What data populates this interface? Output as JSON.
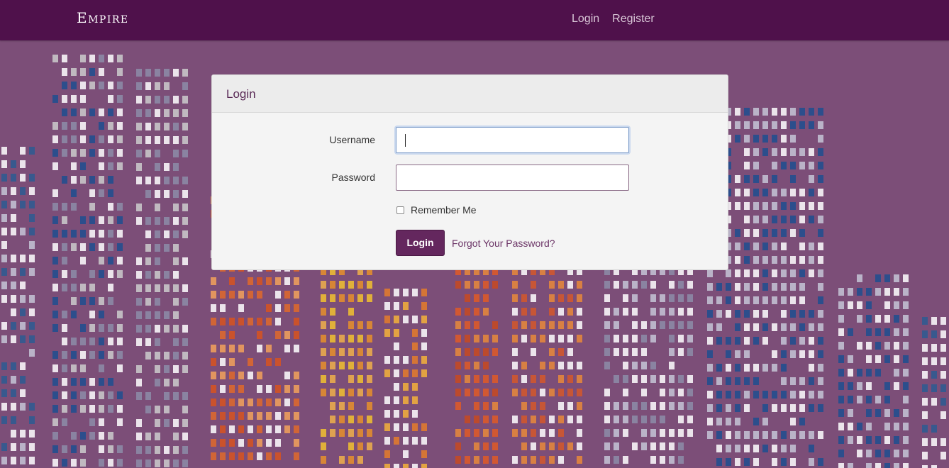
{
  "navbar": {
    "brand": "Empire",
    "links": [
      {
        "label": "Login"
      },
      {
        "label": "Register"
      }
    ]
  },
  "login_panel": {
    "title": "Login",
    "username_label": "Username",
    "username_value": "",
    "password_label": "Password",
    "password_value": "",
    "remember_label": "Remember Me",
    "remember_checked": false,
    "submit_label": "Login",
    "forgot_label": "Forgot Your Password?"
  },
  "colors": {
    "navbar": "#4f114b",
    "background": "#7c4e78",
    "button": "#64275e",
    "accent_text": "#6b3466"
  }
}
